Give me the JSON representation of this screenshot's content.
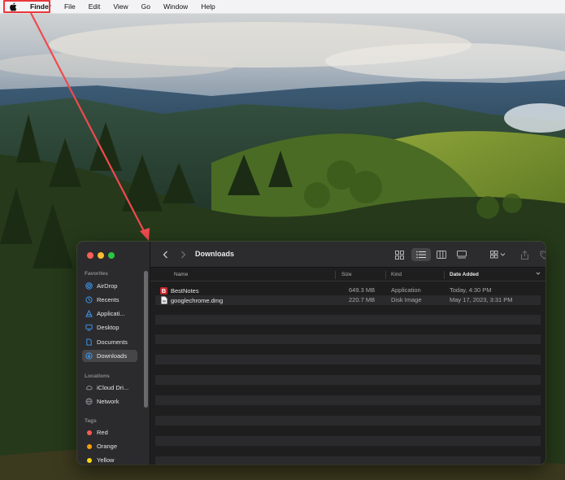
{
  "menubar": {
    "apple_icon": "apple-logo-icon",
    "items": [
      "Finder",
      "File",
      "Edit",
      "View",
      "Go",
      "Window",
      "Help"
    ],
    "highlight_color": "#e8383d"
  },
  "window": {
    "title": "Downloads",
    "traffic_colors": [
      "#ff5f57",
      "#febc2e",
      "#28c840"
    ],
    "sidebar": {
      "favorites_label": "Favorites",
      "favorites": [
        {
          "label": "AirDrop",
          "icon": "airdrop-icon"
        },
        {
          "label": "Recents",
          "icon": "clock-icon"
        },
        {
          "label": "Applicati...",
          "icon": "applications-icon"
        },
        {
          "label": "Desktop",
          "icon": "desktop-icon"
        },
        {
          "label": "Documents",
          "icon": "document-icon"
        },
        {
          "label": "Downloads",
          "icon": "download-icon",
          "selected": true
        }
      ],
      "locations_label": "Locations",
      "locations": [
        {
          "label": "iCloud Dri...",
          "icon": "cloud-icon"
        },
        {
          "label": "Network",
          "icon": "globe-icon"
        }
      ],
      "tags_label": "Tags",
      "tags": [
        {
          "label": "Red",
          "color": "#ff5a52"
        },
        {
          "label": "Orange",
          "color": "#ff9f0a"
        },
        {
          "label": "Yellow",
          "color": "#ffd60a"
        }
      ]
    },
    "columns": {
      "name": "Name",
      "size": "Size",
      "kind": "Kind",
      "date": "Date Added"
    },
    "files": [
      {
        "name": "BestNotes",
        "size": "649.3 MB",
        "kind": "Application",
        "date": "Today, 4:30 PM",
        "icon": "bestnotes-app-icon"
      },
      {
        "name": "googlechrome.dmg",
        "size": "220.7 MB",
        "kind": "Disk Image",
        "date": "May 17, 2023, 3:31 PM",
        "icon": "disk-image-icon"
      }
    ]
  }
}
